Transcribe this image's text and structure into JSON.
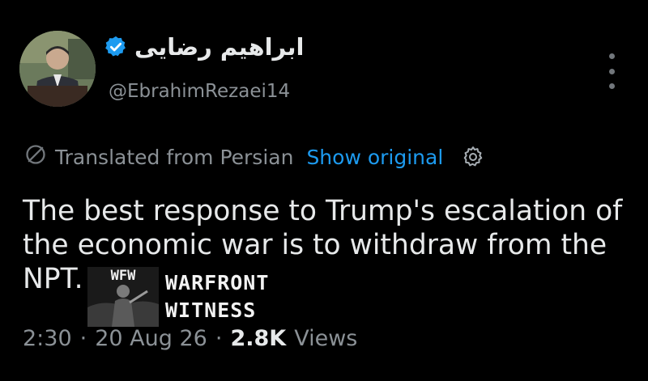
{
  "author": {
    "display_name": "ابراهیم رضایی",
    "handle": "@EbrahimRezaei14",
    "verified": true,
    "avatar_icon": "profile-photo"
  },
  "translation": {
    "label": "Translated from Persian",
    "show_original": "Show original",
    "settings_icon": "gear-icon"
  },
  "tweet": {
    "text": "The best response to Trump's escalation of the economic war is to withdraw from the NPT."
  },
  "watermark": {
    "logo_text": "WFW",
    "line1": "WARFRONT",
    "line2": "WITNESS"
  },
  "meta": {
    "time": "2:30",
    "date": "20 Aug 26",
    "views_count": "2.8K",
    "views_label": "Views",
    "separator": "·"
  },
  "colors": {
    "background": "#000000",
    "primary_text": "#e7e9ea",
    "secondary_text": "#71767b",
    "accent": "#1d9bf0"
  }
}
